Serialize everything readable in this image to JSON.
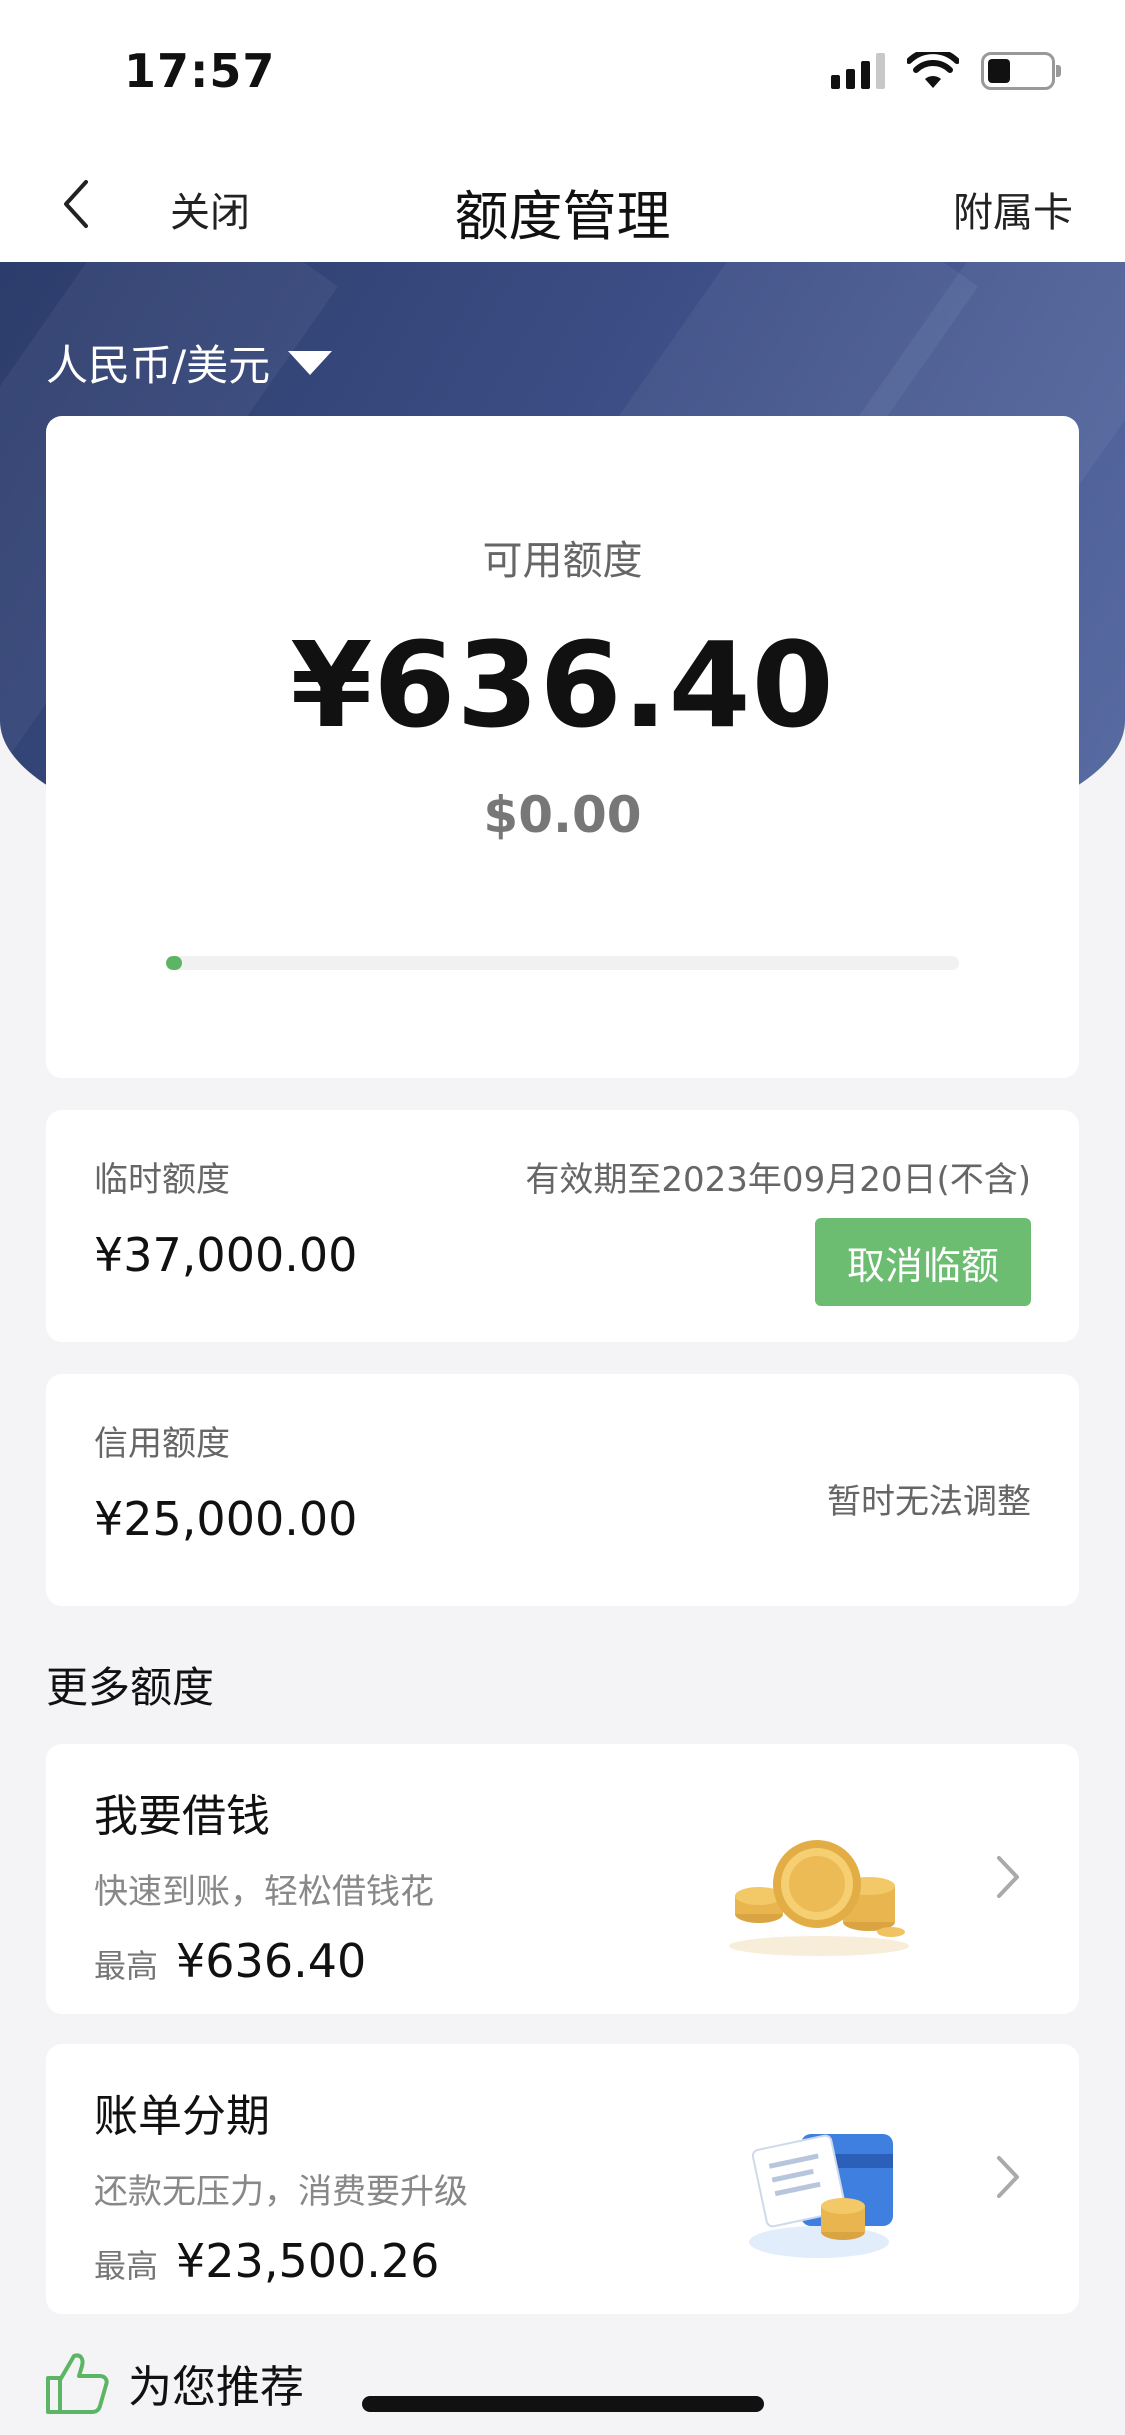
{
  "status_bar": {
    "time": "17:57",
    "battery_level": 0.35,
    "signal_bars_active": 3,
    "signal_bars_total": 4
  },
  "nav": {
    "close_label": "关闭",
    "title": "额度管理",
    "right_label": "附属卡"
  },
  "currency_selector": {
    "label": "人民币/美元"
  },
  "available": {
    "label": "可用额度",
    "amount_cny": "¥636.40",
    "amount_usd": "$0.00",
    "usage_progress": 0.02
  },
  "temporary_limit": {
    "label": "临时额度",
    "amount": "¥37,000.00",
    "expiry": "有效期至2023年09月20日(不含)",
    "cancel_button": "取消临额"
  },
  "credit_limit": {
    "label": "信用额度",
    "amount": "¥25,000.00",
    "note": "暂时无法调整"
  },
  "more_section": {
    "title": "更多额度"
  },
  "loan": {
    "title": "我要借钱",
    "subtitle": "快速到账，轻松借钱花",
    "max_label": "最高",
    "max_amount": "¥636.40"
  },
  "installment": {
    "title": "账单分期",
    "subtitle": "还款无压力，消费要升级",
    "max_label": "最高",
    "max_amount": "¥23,500.26"
  },
  "recommend": {
    "label": "为您推荐"
  },
  "colors": {
    "hero_dark": "#2c3c6b",
    "accent_green": "#6cbc72",
    "progress_green": "#5cb565"
  },
  "icons": [
    "back-chevron-icon",
    "caret-down-icon",
    "coins-icon",
    "bill-card-icon",
    "chevron-right-icon",
    "thumbs-up-icon",
    "signal-icon",
    "wifi-icon",
    "battery-icon"
  ]
}
